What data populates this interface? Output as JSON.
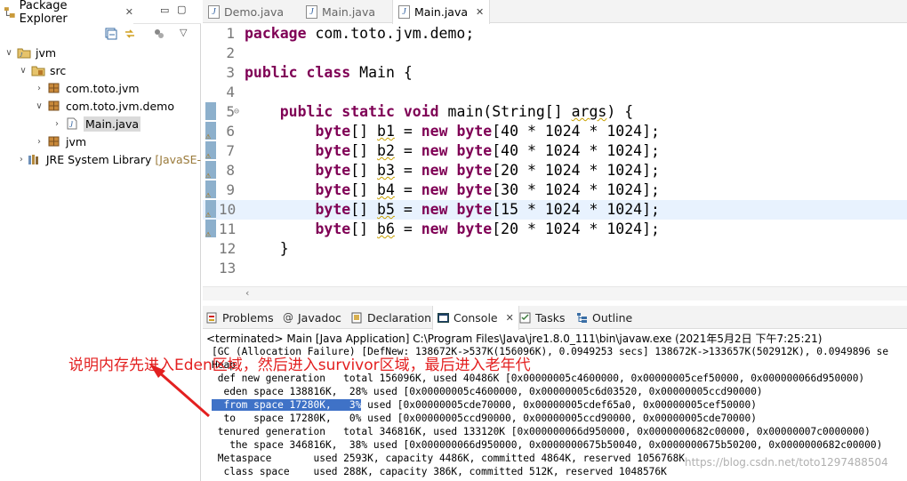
{
  "package_explorer": {
    "title": "Package Explorer",
    "tree": [
      {
        "label": "jvm",
        "icon": "project-icon",
        "twisty": "open"
      },
      {
        "label": "src",
        "icon": "source-folder-icon",
        "twisty": "open"
      },
      {
        "label": "com.toto.jvm",
        "icon": "package-icon",
        "twisty": "closed"
      },
      {
        "label": "com.toto.jvm.demo",
        "icon": "package-icon",
        "twisty": "open"
      },
      {
        "label": "Main.java",
        "icon": "java-file-icon",
        "twisty": "closed"
      },
      {
        "label": "jvm",
        "icon": "package-icon",
        "twisty": "closed"
      },
      {
        "label": "JRE System Library",
        "suffix": "[JavaSE-",
        "icon": "library-icon",
        "twisty": "closed"
      }
    ]
  },
  "editor": {
    "tabs": [
      {
        "label": "Demo.java",
        "active": false
      },
      {
        "label": "Main.java",
        "active": false
      },
      {
        "label": "Main.java",
        "active": true
      }
    ],
    "lines": [
      {
        "n": "1",
        "tokens": [
          [
            "kw",
            "package"
          ],
          [
            "t",
            " com.toto.jvm.demo;"
          ]
        ]
      },
      {
        "n": "2",
        "tokens": []
      },
      {
        "n": "3",
        "tokens": [
          [
            "kw",
            "public"
          ],
          [
            "t",
            " "
          ],
          [
            "kw",
            "class"
          ],
          [
            "t",
            " Main {"
          ]
        ]
      },
      {
        "n": "4",
        "tokens": []
      },
      {
        "n": "5",
        "tokens": [
          [
            "t",
            "    "
          ],
          [
            "kw",
            "public"
          ],
          [
            "t",
            " "
          ],
          [
            "kw",
            "static"
          ],
          [
            "t",
            " "
          ],
          [
            "kw",
            "void"
          ],
          [
            "t",
            " main(String[] "
          ],
          [
            "v",
            "args"
          ],
          [
            "t",
            ") {"
          ]
        ]
      },
      {
        "n": "6",
        "tokens": [
          [
            "t",
            "        "
          ],
          [
            "kw",
            "byte"
          ],
          [
            "t",
            "[] "
          ],
          [
            "v",
            "b1"
          ],
          [
            "t",
            " = "
          ],
          [
            "kw",
            "new"
          ],
          [
            "t",
            " "
          ],
          [
            "kw",
            "byte"
          ],
          [
            "t",
            "[40 * 1024 * 1024];"
          ]
        ]
      },
      {
        "n": "7",
        "tokens": [
          [
            "t",
            "        "
          ],
          [
            "kw",
            "byte"
          ],
          [
            "t",
            "[] "
          ],
          [
            "v",
            "b2"
          ],
          [
            "t",
            " = "
          ],
          [
            "kw",
            "new"
          ],
          [
            "t",
            " "
          ],
          [
            "kw",
            "byte"
          ],
          [
            "t",
            "[40 * 1024 * 1024];"
          ]
        ]
      },
      {
        "n": "8",
        "tokens": [
          [
            "t",
            "        "
          ],
          [
            "kw",
            "byte"
          ],
          [
            "t",
            "[] "
          ],
          [
            "v",
            "b3"
          ],
          [
            "t",
            " = "
          ],
          [
            "kw",
            "new"
          ],
          [
            "t",
            " "
          ],
          [
            "kw",
            "byte"
          ],
          [
            "t",
            "[20 * 1024 * 1024];"
          ]
        ]
      },
      {
        "n": "9",
        "tokens": [
          [
            "t",
            "        "
          ],
          [
            "kw",
            "byte"
          ],
          [
            "t",
            "[] "
          ],
          [
            "v",
            "b4"
          ],
          [
            "t",
            " = "
          ],
          [
            "kw",
            "new"
          ],
          [
            "t",
            " "
          ],
          [
            "kw",
            "byte"
          ],
          [
            "t",
            "[30 * 1024 * 1024];"
          ]
        ]
      },
      {
        "n": "10",
        "tokens": [
          [
            "t",
            "        "
          ],
          [
            "kw",
            "byte"
          ],
          [
            "t",
            "[] "
          ],
          [
            "v",
            "b5"
          ],
          [
            "t",
            " = "
          ],
          [
            "kw",
            "new"
          ],
          [
            "t",
            " "
          ],
          [
            "kw",
            "byte"
          ],
          [
            "t",
            "[15 * 1024 * 1024];"
          ]
        ],
        "highlight": true
      },
      {
        "n": "11",
        "tokens": [
          [
            "t",
            "        "
          ],
          [
            "kw",
            "byte"
          ],
          [
            "t",
            "[] "
          ],
          [
            "v",
            "b6"
          ],
          [
            "t",
            " = "
          ],
          [
            "kw",
            "new"
          ],
          [
            "t",
            " "
          ],
          [
            "kw",
            "byte"
          ],
          [
            "t",
            "[20 * 1024 * 1024];"
          ]
        ]
      },
      {
        "n": "12",
        "tokens": [
          [
            "t",
            "    }"
          ]
        ]
      },
      {
        "n": "13",
        "tokens": []
      }
    ]
  },
  "bottom_panel": {
    "tabs": [
      {
        "label": "Problems",
        "icon": "problems-icon"
      },
      {
        "label": "Javadoc",
        "icon": "at-icon"
      },
      {
        "label": "Declaration",
        "icon": "declaration-icon"
      },
      {
        "label": "Console",
        "icon": "console-icon",
        "active": true
      },
      {
        "label": "Tasks",
        "icon": "tasks-icon"
      },
      {
        "label": "Outline",
        "icon": "outline-icon"
      }
    ],
    "terminated": "<terminated> Main [Java Application] C:\\Program Files\\Java\\jre1.8.0_111\\bin\\javaw.exe (2021年5月2日 下午7:25:21)",
    "console_lines": [
      {
        "text": "[GC (Allocation Failure) [DefNew: 138672K->537K(156096K), 0.0949253 secs] 138672K->133657K(502912K), 0.0949896 se"
      },
      {
        "text": "Heap"
      },
      {
        "text": " def new generation   total 156096K, used 40486K [0x00000005c4600000, 0x00000005cef50000, 0x000000066d950000)"
      },
      {
        "text": "  eden space 138816K,  28% used [0x00000005c4600000, 0x00000005c6d03520, 0x00000005ccd90000)"
      },
      {
        "text_sel": "  from space 17280K,   3%",
        "text": " used [0x00000005cde70000, 0x00000005cdef65a0, 0x00000005cef50000)"
      },
      {
        "text": "  to   space 17280K,   0% used [0x00000005ccd90000, 0x00000005ccd90000, 0x00000005cde70000)"
      },
      {
        "text": " tenured generation   total 346816K, used 133120K [0x000000066d950000, 0x0000000682c00000, 0x00000007c0000000)"
      },
      {
        "text": "   the space 346816K,  38% used [0x000000066d950000, 0x0000000675b50040, 0x0000000675b50200, 0x0000000682c00000)"
      },
      {
        "text": " Metaspace       used 2593K, capacity 4486K, committed 4864K, reserved 1056768K"
      },
      {
        "text": "  class space    used 288K, capacity 386K, committed 512K, reserved 1048576K"
      }
    ]
  },
  "annotation": {
    "text": "说明内存先进入Eden区域，然后进入survivor区域，最后进入老年代",
    "color": "#e32020"
  },
  "watermark": "https://blog.csdn.net/toto1297488504"
}
